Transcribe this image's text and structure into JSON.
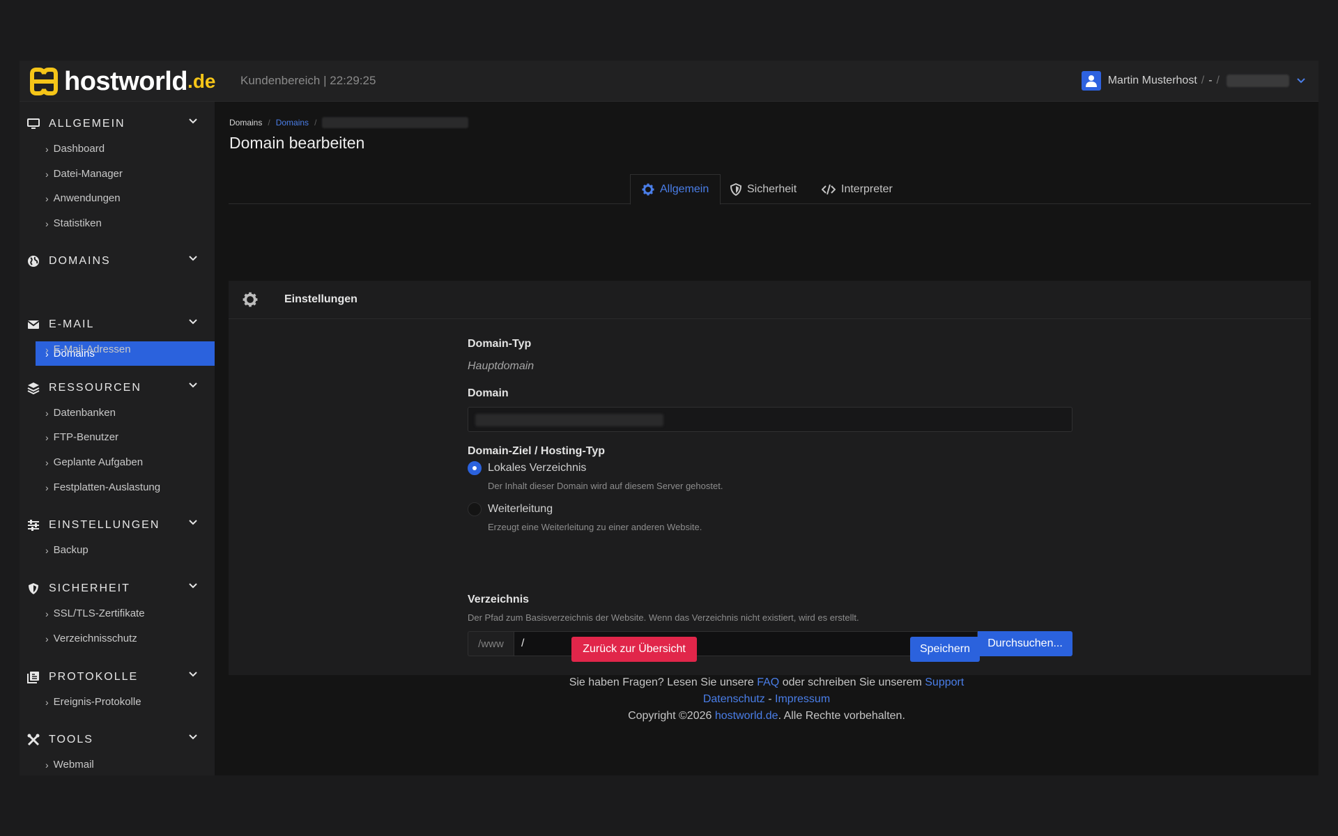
{
  "header": {
    "logo_text": "hostworld",
    "logo_tld": ".de",
    "area": "Kundenbereich",
    "separator": "|",
    "time": "22:29:25",
    "user_name": "Martin Musterhost",
    "user_sep1": "/",
    "user_dash": "-",
    "user_sep2": "/",
    "accent_color": "#2b62dd",
    "logo_color": "#f5c518"
  },
  "sidebar": {
    "sections": [
      {
        "title": "ALLGEMEIN",
        "icon": "monitor-icon",
        "items": [
          "Dashboard",
          "Datei-Manager",
          "Anwendungen",
          "Statistiken"
        ]
      },
      {
        "title": "DOMAINS",
        "icon": "globe-icon",
        "items": [
          "Domains"
        ]
      },
      {
        "title": "E-MAIL",
        "icon": "envelope-icon",
        "items": [
          "E-Mail-Adressen"
        ]
      },
      {
        "title": "RESSOURCEN",
        "icon": "layers-icon",
        "items": [
          "Datenbanken",
          "FTP-Benutzer",
          "Geplante Aufgaben",
          "Festplatten-Auslastung"
        ]
      },
      {
        "title": "EINSTELLUNGEN",
        "icon": "sliders-icon",
        "items": [
          "Backup"
        ]
      },
      {
        "title": "SICHERHEIT",
        "icon": "shield-icon",
        "items": [
          "SSL/TLS-Zertifikate",
          "Verzeichnisschutz"
        ]
      },
      {
        "title": "PROTOKOLLE",
        "icon": "log-icon",
        "items": [
          "Ereignis-Protokolle"
        ]
      },
      {
        "title": "TOOLS",
        "icon": "tools-icon",
        "items": [
          "Webmail"
        ]
      }
    ],
    "active_item": "Domains"
  },
  "breadcrumb": {
    "root": "Domains",
    "link": "Domains",
    "sep": "/"
  },
  "page": {
    "title": "Domain bearbeiten"
  },
  "tabs": [
    {
      "label": "Allgemein",
      "icon": "gear-icon",
      "active": true
    },
    {
      "label": "Sicherheit",
      "icon": "shield-icon",
      "active": false
    },
    {
      "label": "Interpreter",
      "icon": "code-icon",
      "active": false
    }
  ],
  "card": {
    "title": "Einstellungen",
    "domain_type_label": "Domain-Typ",
    "domain_type_value": "Hauptdomain",
    "domain_label": "Domain",
    "target_label": "Domain-Ziel / Hosting-Typ",
    "options": [
      {
        "label": "Lokales Verzeichnis",
        "help": "Der Inhalt dieser Domain wird auf diesem Server gehostet.",
        "selected": true
      },
      {
        "label": "Weiterleitung",
        "help": "Erzeugt eine Weiterleitung zu einer anderen Website.",
        "selected": false
      }
    ],
    "dir_label": "Verzeichnis",
    "dir_help": "Der Pfad zum Basisverzeichnis der Website. Wenn das Verzeichnis nicht existiert, wird es erstellt.",
    "dir_prefix": "/www",
    "dir_value": "/",
    "browse_label": "Durchsuchen...",
    "back_label": "Zurück zur Übersicht",
    "save_label": "Speichern"
  },
  "footer": {
    "q_prefix": "Sie haben Fragen? Lesen Sie unsere",
    "faq": "FAQ",
    "q_mid": "oder schreiben Sie unserem",
    "support": "Support",
    "privacy": "Datenschutz",
    "dash": "-",
    "imprint": "Impressum",
    "copyright_prefix": "Copyright ©2026",
    "brand": "hostworld.de",
    "copyright_suffix": ". Alle Rechte vorbehalten."
  }
}
